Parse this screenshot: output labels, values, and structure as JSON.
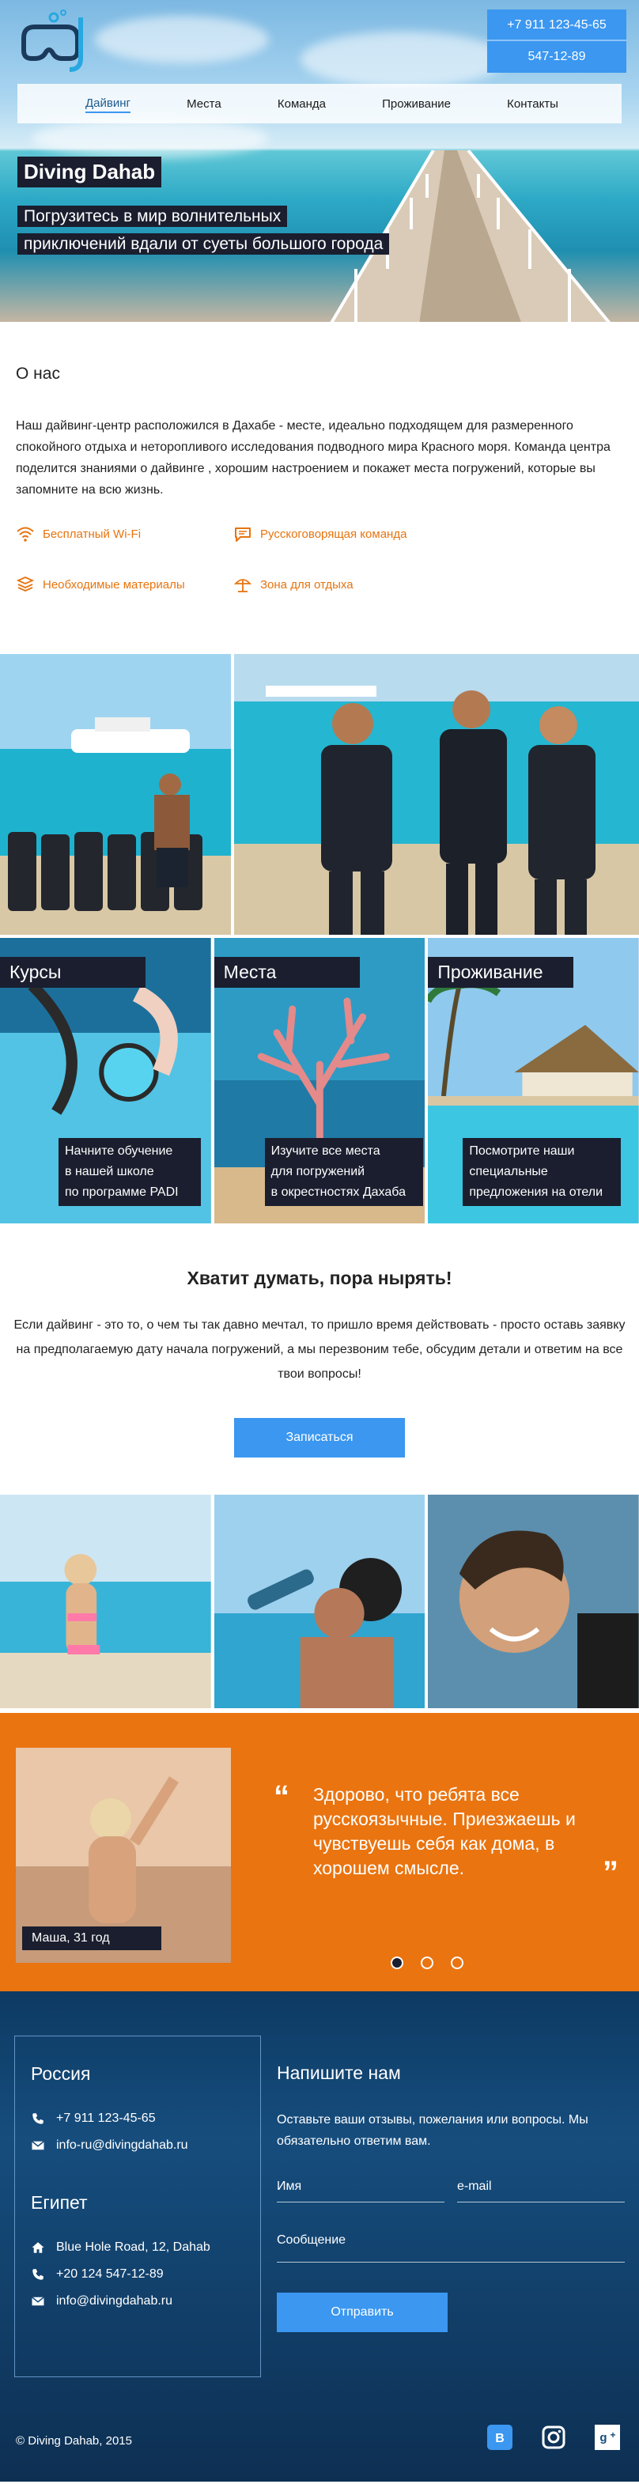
{
  "header": {
    "phones": [
      "+7 911 123-45-65",
      "547-12-89"
    ],
    "nav": [
      {
        "label": "Дайвинг",
        "active": true
      },
      {
        "label": "Места",
        "active": false
      },
      {
        "label": "Команда",
        "active": false
      },
      {
        "label": "Проживание",
        "active": false
      },
      {
        "label": "Контакты",
        "active": false
      }
    ],
    "title": "Diving Dahab",
    "subtitle_lines": [
      "Погрузитесь в мир волнительных",
      "приключений вдали от суеты большого города"
    ]
  },
  "about": {
    "heading": "О нас",
    "text": "Наш дайвинг-центр расположился в Дахабе - месте, идеально подходящем для размеренного спокойного отдыха и неторопливого исследования подводного мира Красного моря. Команда центра поделится знаниями о дайвинге , хорошим настроением и покажет места погружений, которые вы запомните на всю жизнь.",
    "features": [
      {
        "icon": "wifi-icon",
        "label": "Бесплатный Wi-Fi"
      },
      {
        "icon": "chat-icon",
        "label": "Русскоговорящая команда"
      },
      {
        "icon": "materials-icon",
        "label": "Необходимые материалы"
      },
      {
        "icon": "beach-umbrella-icon",
        "label": "Зона для отдыха"
      }
    ],
    "accent_color": "#e6740f"
  },
  "cards": [
    {
      "title": "Курсы",
      "desc": [
        "Начните обучение",
        "в нашей школе",
        "по программе PADI"
      ]
    },
    {
      "title": "Места",
      "desc": [
        "Изучите все места",
        "для погружений",
        "в окрестностях Дахаба"
      ]
    },
    {
      "title": "Проживание",
      "desc": [
        "Посмотрите наши",
        "специальные",
        "предложения на отели"
      ]
    }
  ],
  "cta": {
    "heading": "Хватит думать, пора нырять!",
    "text": "Если дайвинг - это то, о чем ты так давно мечтал,  то пришло время действовать - просто оставь заявку  на предполагаемую дату начала погружений, а мы перезвоним тебе, обсудим детали и ответим на все твои вопросы!",
    "button": "Записаться"
  },
  "testimonial": {
    "quote": "Здорово, что ребята все русскоязычные. Приезжаешь и чувствуешь себя как дома, в хорошем смысле.",
    "open_quote": "“",
    "close_quote": "”",
    "name": "Маша, 31 год",
    "background": "#ea7410"
  },
  "footer": {
    "russia": {
      "heading": "Россия",
      "phone": "+7 911 123-45-65",
      "email": "info-ru@divingdahab.ru"
    },
    "egypt": {
      "heading": "Египет",
      "address": "Blue Hole Road, 12, Dahab",
      "phone": "+20 124 547-12-89",
      "email": "info@divingdahab.ru"
    },
    "form": {
      "heading": "Напишите нам",
      "text": "Оставьте ваши отзывы, пожелания или вопросы. Мы обязательно ответим вам.",
      "name_placeholder": "Имя",
      "email_placeholder": "e-mail",
      "message_placeholder": "Сообщение",
      "submit": "Отправить"
    },
    "copyright": "© Diving Dahab, 2015",
    "socials": [
      "vk-icon",
      "instagram-icon",
      "google-plus-icon"
    ]
  },
  "brand_blue": "#3b97f0",
  "dark_label": "#1a1e2e"
}
